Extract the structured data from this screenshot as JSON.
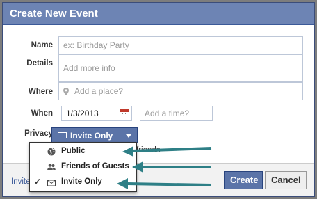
{
  "dialog": {
    "title": "Create New Event"
  },
  "form": {
    "name_label": "Name",
    "name_placeholder": "ex: Birthday Party",
    "details_label": "Details",
    "details_placeholder": "Add more info",
    "where_label": "Where",
    "where_placeholder": "Add a place?",
    "when_label": "When",
    "date_value": "1/3/2013",
    "time_placeholder": "Add a time?",
    "privacy_label": "Privacy",
    "privacy_value": "Invite Only"
  },
  "background_text": {
    "friends_fragment": "friends"
  },
  "privacy_menu": {
    "items": [
      {
        "label": "Public",
        "icon": "globe-icon",
        "selected": false
      },
      {
        "label": "Friends of Guests",
        "icon": "people-icon",
        "selected": false
      },
      {
        "label": "Invite Only",
        "icon": "envelope-icon",
        "selected": true
      }
    ],
    "check_glyph": "✓"
  },
  "footer": {
    "invite_link": "Invite",
    "create_label": "Create",
    "cancel_label": "Cancel"
  },
  "colors": {
    "title_bar": "#6d84b4",
    "primary_button": "#5b74a8",
    "annotation_arrow": "#2e7f86"
  }
}
